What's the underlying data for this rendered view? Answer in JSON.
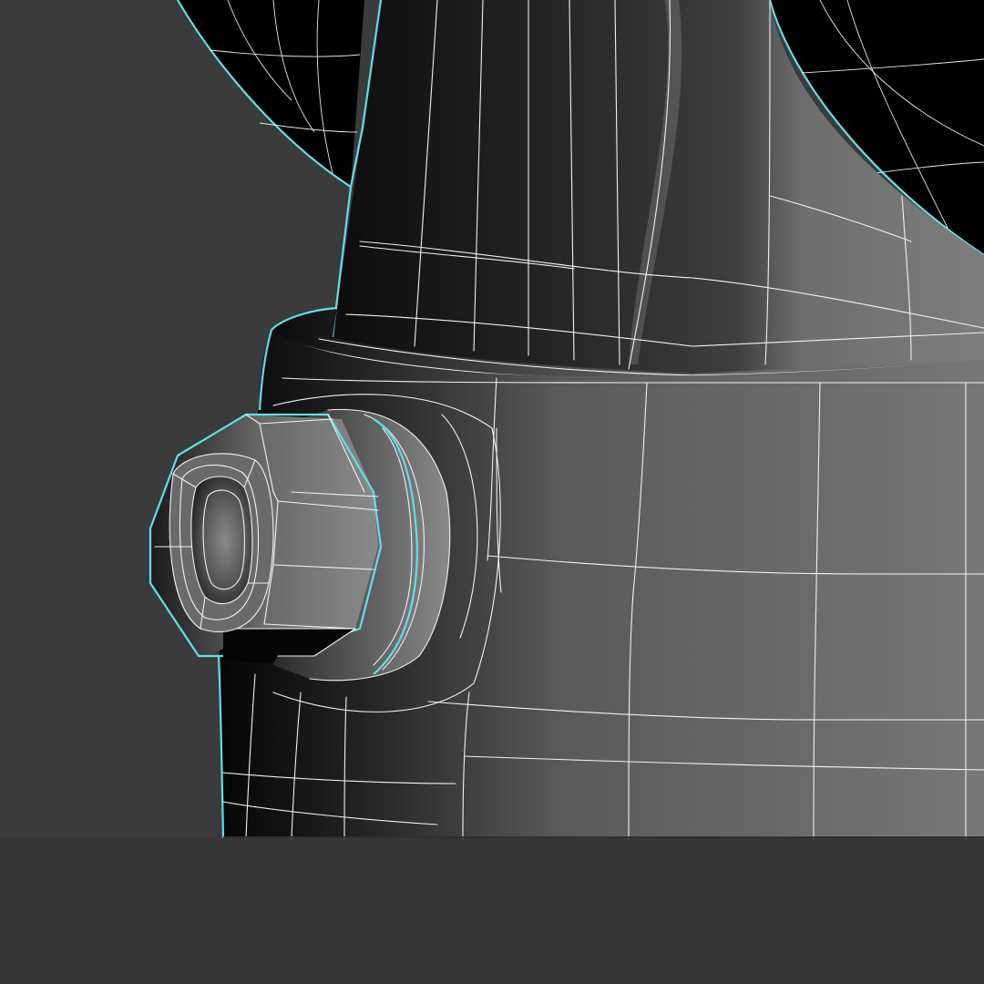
{
  "viewport": {
    "mode": "wireframe-on-shaded",
    "selection_color": "#5fe0ea",
    "wire_color": "#f2f2f2",
    "background_color": "#3b3b3b",
    "selected": true
  }
}
